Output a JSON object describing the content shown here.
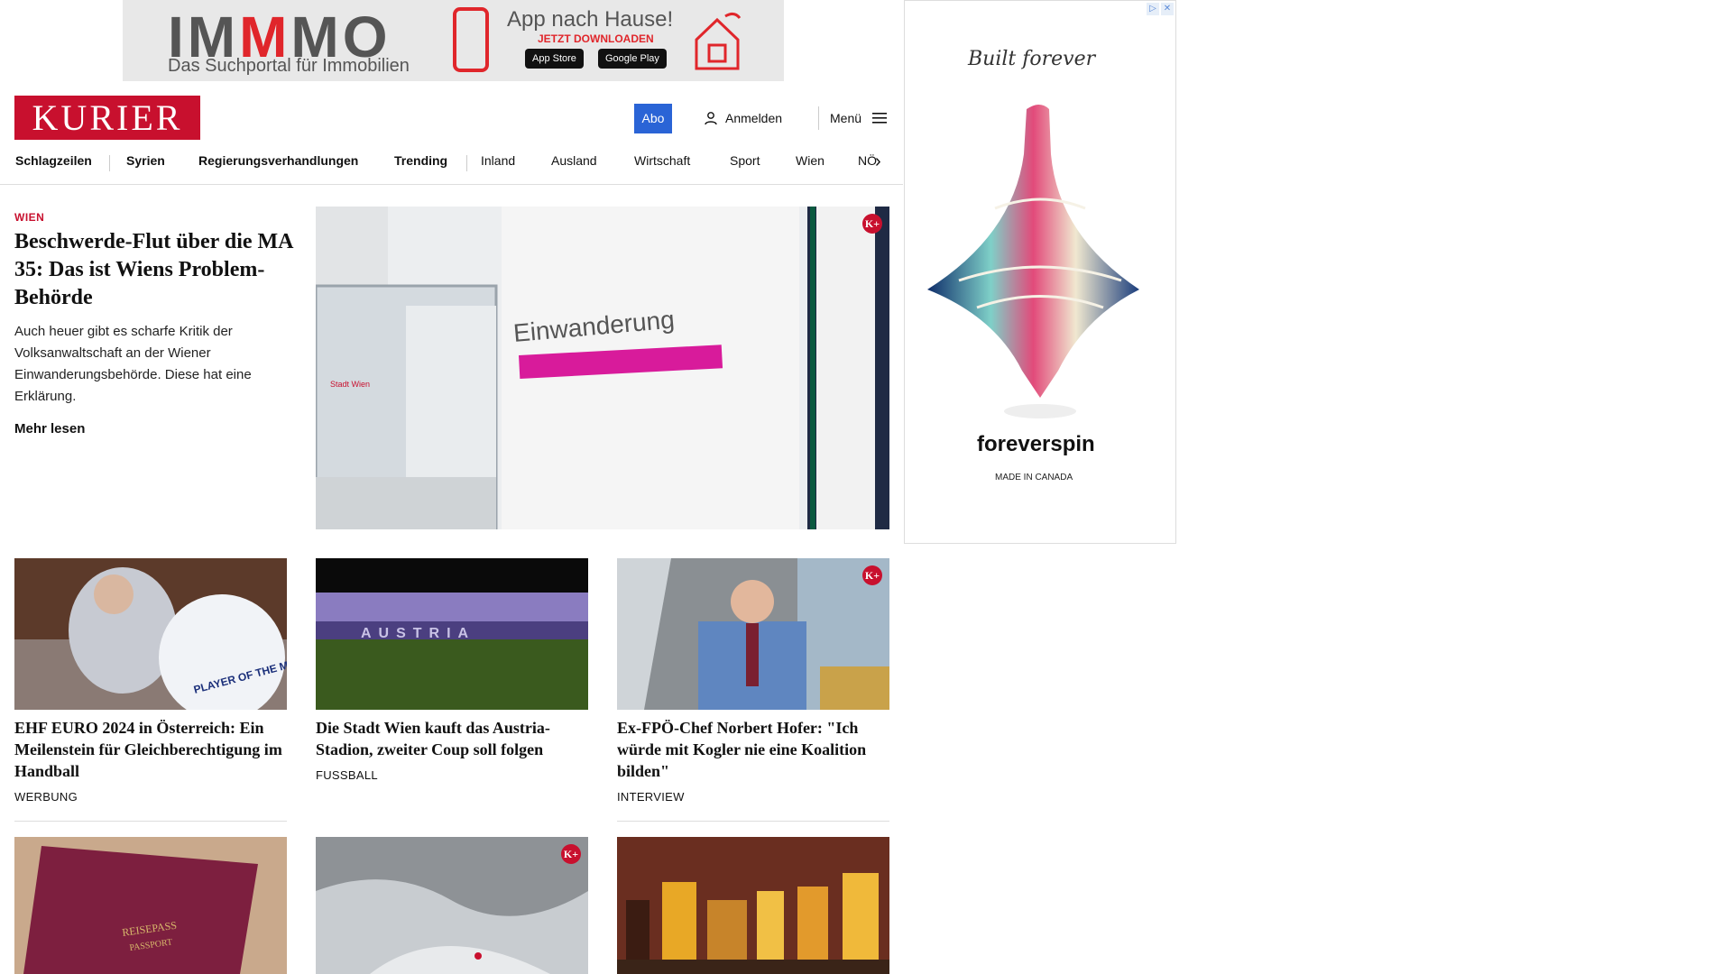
{
  "top_ad": {
    "brand_part1": "IM",
    "brand_part2": "M",
    "brand_part3": "MO",
    "tagline": "Das Suchportal für Immobilien",
    "cta_title": "App nach Hause!",
    "cta_sub": "JETZT DOWNLOADEN",
    "store1": "App Store",
    "store2": "Google Play"
  },
  "header": {
    "logo": "KURIER",
    "abo_label": "Abo",
    "login_label": "Anmelden",
    "menu_label": "Menü"
  },
  "nav": {
    "items": [
      "Schlagzeilen",
      "Syrien",
      "Regierungsverhandlungen",
      "Trending",
      "Inland",
      "Ausland",
      "Wirtschaft",
      "Sport",
      "Wien",
      "NÖ"
    ]
  },
  "hero": {
    "kicker": "WIEN",
    "title": "Beschwerde-Flut über die MA 35: Das ist Wiens Pro­blem-Behörde",
    "teaser": "Auch heuer gibt es scharfe Kritik der Volksanwaltschaft an der Wiener Einwanderungsbehörde. Diese hat eine Erklärung.",
    "more_label": "Mehr lesen",
    "image_text_sign": "Einwanderung",
    "image_text_logo": "Stadt Wien",
    "premium_badge": "K+"
  },
  "cards": [
    {
      "title": "EHF EURO 2024 in Österreich: Ein Meilenstein für Gleichberechti­gung im Handball",
      "kicker": "WERBUNG",
      "badge": "",
      "img_text": "PLAYER OF THE MATCH"
    },
    {
      "title": "Die Stadt Wien kauft das Austria-Stadion, zweiter Coup soll folgen",
      "kicker": "FUSSBALL",
      "badge": "",
      "img_text": "AUSTRIA"
    },
    {
      "title": "Ex-FPÖ-Chef Norbert Hofer: \"Ich würde mit Kogler nie eine Koali­tion bilden\"",
      "kicker": "INTERVIEW",
      "badge": "K+",
      "img_text": ""
    }
  ],
  "row2": [
    {
      "badge": "",
      "img_text1": "REISEPASS",
      "img_text2": "PASSPORT"
    },
    {
      "badge": "K+"
    },
    {
      "badge": ""
    }
  ],
  "side_ad": {
    "script_text": "Built forever",
    "brand": "foreverspin",
    "made_in": "MADE IN CANADA"
  },
  "colors": {
    "brand_red": "#c8102e",
    "abo_blue": "#2a64d6"
  }
}
